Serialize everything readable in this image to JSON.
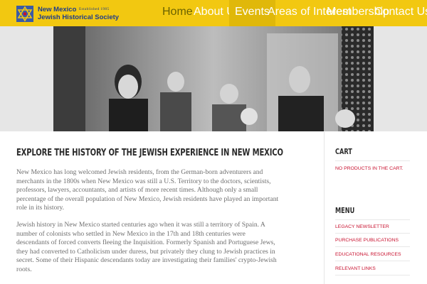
{
  "logo": {
    "line1": "New Mexico",
    "established": "Established 1985",
    "line2": "Jewish Historical Society"
  },
  "nav": {
    "items": [
      "Home",
      "About Us",
      "Events",
      "Areas of Interest",
      "Membership",
      "Contact Us"
    ],
    "active": "Home",
    "highlighted": "Events"
  },
  "hero": {
    "image": "historical-family-photograph"
  },
  "main": {
    "title": "EXPLORE THE HISTORY OF THE JEWISH EXPERIENCE IN NEW MEXICO",
    "paragraph1_lines": [
      "New Mexico has long welcomed Jewish residents, from the German-born adventurers and",
      "merchants in the 1800s when New Mexico was still a U.S. Territory to the doctors, scientists,",
      "professors, lawyers, accountants, and artists of more recent times. Although only a small",
      "percentage of the overall population of New Mexico, Jewish residents have played an important",
      "role in its history."
    ],
    "paragraph2_lines": [
      "Jewish history in New Mexico started centuries ago when it was still a territory of Spain. A",
      "number of colonists who settled in New Mexico in the 17th and 18th centuries were",
      "descendants of forced converts fleeing the Inquisition. Formerly Spanish and Portuguese Jews,",
      "they had converted to Catholicism under duress, but privately they clung to Jewish practices in",
      "secret. Some of their Hispanic descendants today are investigating their families' crypto-Jewish",
      "roots."
    ]
  },
  "sidebar": {
    "cart_heading": "CART",
    "cart_empty": "NO PRODUCTS IN THE CART.",
    "menu_heading": "MENU",
    "menu_links": [
      "LEGACY NEWSLETTER",
      "PURCHASE PUBLICATIONS",
      "EDUCATIONAL RESOURCES",
      "RELEVANT LINKS"
    ]
  },
  "colors": {
    "header_bg": "#f2c811",
    "nav_active": "#6b6200",
    "link_red": "#c8102e",
    "logo_blue": "#1f3d8a"
  }
}
